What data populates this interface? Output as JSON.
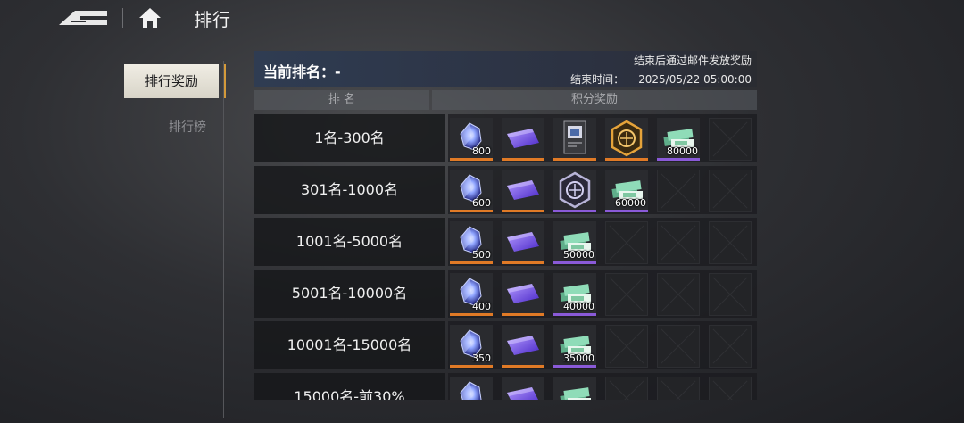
{
  "header": {
    "title": "排行",
    "icons": {
      "back": "back-arrow-icon",
      "home": "home-icon"
    }
  },
  "sidebar": {
    "items": [
      {
        "label": "排行奖励",
        "active": true
      },
      {
        "label": "排行榜",
        "active": false
      }
    ]
  },
  "panel": {
    "current_rank_label": "当前排名：-",
    "mail_note": "结束后通过邮件发放奖励",
    "end_time_label": "结束时间：",
    "end_time_value": "2025/05/22 05:00:00"
  },
  "columns": {
    "rank": "排 名",
    "rewards": "积分奖励"
  },
  "colors": {
    "accent_orange": "#e07a26",
    "accent_purple": "#8a5ad8",
    "active_tab_marker": "#d49a3a"
  },
  "rows": [
    {
      "rank": "1名-300名",
      "rewards": [
        {
          "icon": "crystal-icon",
          "qty": "800",
          "rarity": "orange"
        },
        {
          "icon": "purple-card-icon",
          "qty": "",
          "rarity": "orange"
        },
        {
          "icon": "avatar-frame-icon",
          "qty": "",
          "rarity": "orange"
        },
        {
          "icon": "gold-emblem-icon",
          "qty": "",
          "rarity": "orange"
        },
        {
          "icon": "cash-stack-icon",
          "qty": "80000",
          "rarity": "purple"
        },
        {
          "icon": "empty-slot",
          "qty": "",
          "rarity": ""
        }
      ]
    },
    {
      "rank": "301名-1000名",
      "rewards": [
        {
          "icon": "crystal-icon",
          "qty": "600",
          "rarity": "orange"
        },
        {
          "icon": "purple-card-icon",
          "qty": "",
          "rarity": "orange"
        },
        {
          "icon": "silver-emblem-icon",
          "qty": "",
          "rarity": "purple"
        },
        {
          "icon": "cash-stack-icon",
          "qty": "60000",
          "rarity": "purple"
        },
        {
          "icon": "empty-slot",
          "qty": "",
          "rarity": ""
        },
        {
          "icon": "empty-slot",
          "qty": "",
          "rarity": ""
        }
      ]
    },
    {
      "rank": "1001名-5000名",
      "rewards": [
        {
          "icon": "crystal-icon",
          "qty": "500",
          "rarity": "orange"
        },
        {
          "icon": "purple-card-icon",
          "qty": "",
          "rarity": "orange"
        },
        {
          "icon": "cash-stack-icon",
          "qty": "50000",
          "rarity": "purple"
        },
        {
          "icon": "empty-slot",
          "qty": "",
          "rarity": ""
        },
        {
          "icon": "empty-slot",
          "qty": "",
          "rarity": ""
        },
        {
          "icon": "empty-slot",
          "qty": "",
          "rarity": ""
        }
      ]
    },
    {
      "rank": "5001名-10000名",
      "rewards": [
        {
          "icon": "crystal-icon",
          "qty": "400",
          "rarity": "orange"
        },
        {
          "icon": "purple-card-icon",
          "qty": "",
          "rarity": "orange"
        },
        {
          "icon": "cash-stack-icon",
          "qty": "40000",
          "rarity": "purple"
        },
        {
          "icon": "empty-slot",
          "qty": "",
          "rarity": ""
        },
        {
          "icon": "empty-slot",
          "qty": "",
          "rarity": ""
        },
        {
          "icon": "empty-slot",
          "qty": "",
          "rarity": ""
        }
      ]
    },
    {
      "rank": "10001名-15000名",
      "rewards": [
        {
          "icon": "crystal-icon",
          "qty": "350",
          "rarity": "orange"
        },
        {
          "icon": "purple-card-icon",
          "qty": "",
          "rarity": "orange"
        },
        {
          "icon": "cash-stack-icon",
          "qty": "35000",
          "rarity": "purple"
        },
        {
          "icon": "empty-slot",
          "qty": "",
          "rarity": ""
        },
        {
          "icon": "empty-slot",
          "qty": "",
          "rarity": ""
        },
        {
          "icon": "empty-slot",
          "qty": "",
          "rarity": ""
        }
      ]
    },
    {
      "rank": "15000名-前30%",
      "rewards": [
        {
          "icon": "crystal-icon",
          "qty": "",
          "rarity": "orange"
        },
        {
          "icon": "purple-card-icon",
          "qty": "",
          "rarity": "orange"
        },
        {
          "icon": "cash-stack-icon",
          "qty": "",
          "rarity": "purple"
        },
        {
          "icon": "empty-slot",
          "qty": "",
          "rarity": ""
        },
        {
          "icon": "empty-slot",
          "qty": "",
          "rarity": ""
        },
        {
          "icon": "empty-slot",
          "qty": "",
          "rarity": ""
        }
      ]
    }
  ]
}
